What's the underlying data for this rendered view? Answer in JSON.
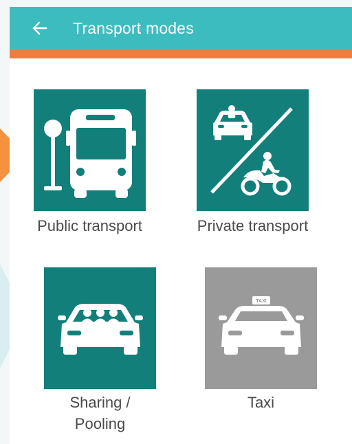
{
  "app_bar": {
    "back_icon": "arrow-left-icon",
    "title": "Transport modes",
    "bar_color": "#3dbcc0",
    "accent_color": "#ee7d3e"
  },
  "modes": [
    {
      "label": "Public transport",
      "icon": "bus-stop-icon",
      "tile_color": "#127f7a"
    },
    {
      "label": "Private transport",
      "icon": "car-motorbike-icon",
      "tile_color": "#127f7a"
    },
    {
      "label_line1": "Sharing /",
      "label_line2": "Pooling",
      "icon": "shared-car-icon",
      "tile_color": "#127f7a"
    },
    {
      "label": "Taxi",
      "icon": "taxi-icon",
      "tile_color": "#9a9a9a",
      "sign_text": "TAXI"
    }
  ]
}
